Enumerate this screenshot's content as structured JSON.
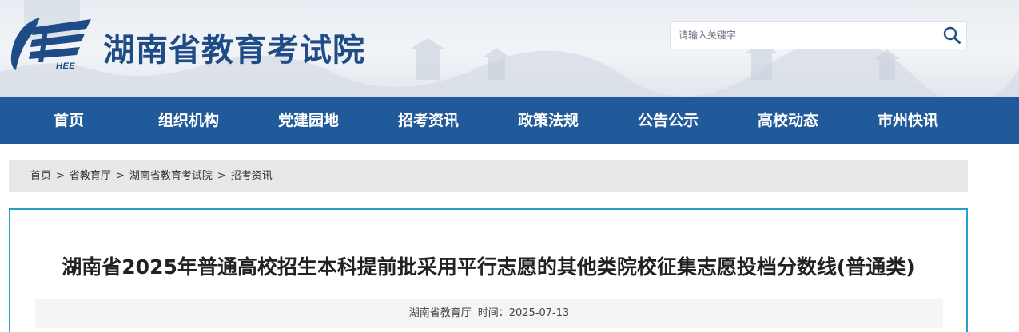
{
  "header": {
    "site_title": "湖南省教育考试院",
    "logo_text": "HEE",
    "search_placeholder": "请输入关键字"
  },
  "colors": {
    "brand_blue": "#1f4c86",
    "nav_background": "#215a9a",
    "content_border": "#2a9fcf",
    "breadcrumb_background": "#e8e8e8"
  },
  "nav": {
    "items": [
      {
        "label": "首页"
      },
      {
        "label": "组织机构"
      },
      {
        "label": "党建园地"
      },
      {
        "label": "招考资讯"
      },
      {
        "label": "政策法规"
      },
      {
        "label": "公告公示"
      },
      {
        "label": "高校动态"
      },
      {
        "label": "市州快讯"
      }
    ]
  },
  "breadcrumb": {
    "items": [
      "首页",
      "省教育厅",
      "湖南省教育考试院",
      "招考资讯"
    ],
    "separator": ">"
  },
  "article": {
    "title": "湖南省2025年普通高校招生本科提前批采用平行志愿的其他类院校征集志愿投档分数线(普通类)",
    "source": "湖南省教育厅",
    "time_label": "时间：",
    "date": "2025-07-13"
  },
  "icons": {
    "logo": "hee-logo-icon",
    "search": "search-icon"
  }
}
